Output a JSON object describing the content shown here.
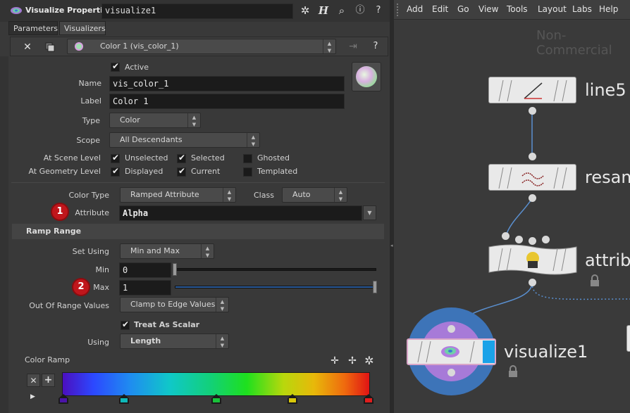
{
  "left_panel": {
    "title": "Visualize Properties",
    "node_path": "visualize1",
    "tabs": [
      "Parameters",
      "Visualizers"
    ],
    "visualizer_select": "Color 1 (vis_color_1)",
    "active_label": "Active",
    "name_label": "Name",
    "name_value": "vis_color_1",
    "label_label": "Label",
    "label_value": "Color 1",
    "type_label": "Type",
    "type_value": "Color",
    "scope_label": "Scope",
    "scope_value": "All Descendants",
    "scene_level_label": "At Scene Level",
    "geometry_level_label": "At Geometry Level",
    "unselected_label": "Unselected",
    "selected_label": "Selected",
    "ghosted_label": "Ghosted",
    "displayed_label": "Displayed",
    "current_label": "Current",
    "templated_label": "Templated",
    "color_type_label": "Color Type",
    "color_type_value": "Ramped Attribute",
    "class_label": "Class",
    "class_value": "Auto",
    "attribute_label": "Attribute",
    "attribute_value": "Alpha",
    "ramp_range_header": "Ramp Range",
    "set_using_label": "Set Using",
    "set_using_value": "Min and Max",
    "min_label": "Min",
    "min_value": "0",
    "max_label": "Max",
    "max_value": "1",
    "out_of_range_label": "Out Of Range Values",
    "out_of_range_value": "Clamp to Edge Values",
    "treat_as_scalar_label": "Treat As Scalar",
    "using_label": "Using",
    "using_value": "Length",
    "color_ramp_label": "Color Ramp",
    "marker_1": "1",
    "marker_2": "2",
    "ramp_key_colors": [
      "#4b14a8",
      "#0fb8b8",
      "#19c23a",
      "#d9c80a",
      "#e01d1d"
    ]
  },
  "network_panel": {
    "menu": [
      "Add",
      "Edit",
      "Go",
      "View",
      "Tools",
      "Layout",
      "Labs",
      "Help"
    ],
    "watermark": "Non-Commercial",
    "nodes": [
      "line5",
      "resam",
      "attrib",
      "visualize1"
    ]
  },
  "colors": {
    "marker_red": "#c0161c",
    "visualize_ring_blue": "#3d74b8",
    "visualize_ring_purple": "#a77ad8",
    "node_flag_blue": "#1aa2e8"
  }
}
